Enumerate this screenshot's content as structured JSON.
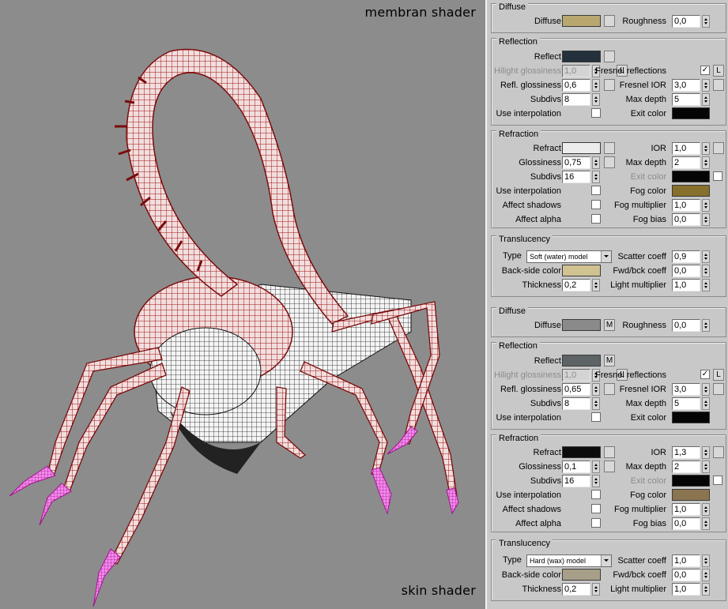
{
  "captions": {
    "top": "membran shader",
    "bottom": "skin shader"
  },
  "membrane": {
    "diffuse": {
      "title": "Diffuse",
      "diffuse_label": "Diffuse",
      "diffuse_color": "#b8a870",
      "roughness_label": "Roughness",
      "roughness": "0,0"
    },
    "reflection": {
      "title": "Reflection",
      "reflect_label": "Reflect",
      "reflect_color": "#24313c",
      "hilight_label": "Hilight glossiness",
      "hilight": "1,0",
      "lock_label": "L",
      "fresnel_label": "Fresnel reflections",
      "fresnel_check": "✓",
      "fresnel_lock": "L",
      "refl_gloss_label": "Refl. glossiness",
      "refl_gloss": "0,6",
      "fresnel_ior_label": "Fresnel IOR",
      "fresnel_ior": "3,0",
      "subdivs_label": "Subdivs",
      "subdivs": "8",
      "max_depth_label": "Max depth",
      "max_depth": "5",
      "interp_label": "Use interpolation",
      "exit_label": "Exit color",
      "exit_color": "#050505"
    },
    "refraction": {
      "title": "Refraction",
      "refract_label": "Refract",
      "refract_color": "#ececec",
      "ior_label": "IOR",
      "ior": "1,0",
      "gloss_label": "Glossiness",
      "gloss": "0,75",
      "max_depth_label": "Max depth",
      "max_depth": "2",
      "subdivs_label": "Subdivs",
      "subdivs": "16",
      "exit_label": "Exit color",
      "exit_color": "#050505",
      "interp_label": "Use interpolation",
      "fog_color_label": "Fog color",
      "fog_color": "#87702c",
      "shadows_label": "Affect shadows",
      "fog_mult_label": "Fog multiplier",
      "fog_mult": "1,0",
      "alpha_label": "Affect alpha",
      "fog_bias_label": "Fog bias",
      "fog_bias": "0,0"
    },
    "translucency": {
      "title": "Translucency",
      "type_label": "Type",
      "type_value": "Soft (water) model",
      "scatter_label": "Scatter coeff",
      "scatter": "0,9",
      "backside_label": "Back-side color",
      "backside_color": "#d0c291",
      "fwdbck_label": "Fwd/bck coeff",
      "fwdbck": "0,0",
      "thickness_label": "Thickness",
      "thickness": "0,2",
      "light_mult_label": "Light multiplier",
      "light_mult": "1,0"
    }
  },
  "skin": {
    "diffuse": {
      "title": "Diffuse",
      "diffuse_label": "Diffuse",
      "diffuse_color": "#8a8a8a",
      "map_label": "M",
      "roughness_label": "Roughness",
      "roughness": "0,0"
    },
    "reflection": {
      "title": "Reflection",
      "reflect_label": "Reflect",
      "reflect_color": "#5e6466",
      "map_label": "M",
      "hilight_label": "Hilight glossiness",
      "hilight": "1,0",
      "lock_label": "L",
      "fresnel_label": "Fresnel reflections",
      "fresnel_check": "✓",
      "fresnel_lock": "L",
      "refl_gloss_label": "Refl. glossiness",
      "refl_gloss": "0,65",
      "fresnel_ior_label": "Fresnel IOR",
      "fresnel_ior": "3,0",
      "subdivs_label": "Subdivs",
      "subdivs": "8",
      "max_depth_label": "Max depth",
      "max_depth": "5",
      "interp_label": "Use interpolation",
      "exit_label": "Exit color",
      "exit_color": "#050505"
    },
    "refraction": {
      "title": "Refraction",
      "refract_label": "Refract",
      "refract_color": "#0c0c0c",
      "ior_label": "IOR",
      "ior": "1,3",
      "gloss_label": "Glossiness",
      "gloss": "0,1",
      "max_depth_label": "Max depth",
      "max_depth": "2",
      "subdivs_label": "Subdivs",
      "subdivs": "16",
      "exit_label": "Exit color",
      "exit_color": "#050505",
      "interp_label": "Use interpolation",
      "fog_color_label": "Fog color",
      "fog_color": "#8a7550",
      "shadows_label": "Affect shadows",
      "fog_mult_label": "Fog multiplier",
      "fog_mult": "1,0",
      "alpha_label": "Affect alpha",
      "fog_bias_label": "Fog bias",
      "fog_bias": "0,0"
    },
    "translucency": {
      "title": "Translucency",
      "type_label": "Type",
      "type_value": "Hard (wax) model",
      "scatter_label": "Scatter coeff",
      "scatter": "1,0",
      "backside_label": "Back-side color",
      "backside_color": "#a79f88",
      "fwdbck_label": "Fwd/bck coeff",
      "fwdbck": "0,0",
      "thickness_label": "Thickness",
      "thickness": "0,2",
      "light_mult_label": "Light multiplier",
      "light_mult": "1,0"
    }
  }
}
